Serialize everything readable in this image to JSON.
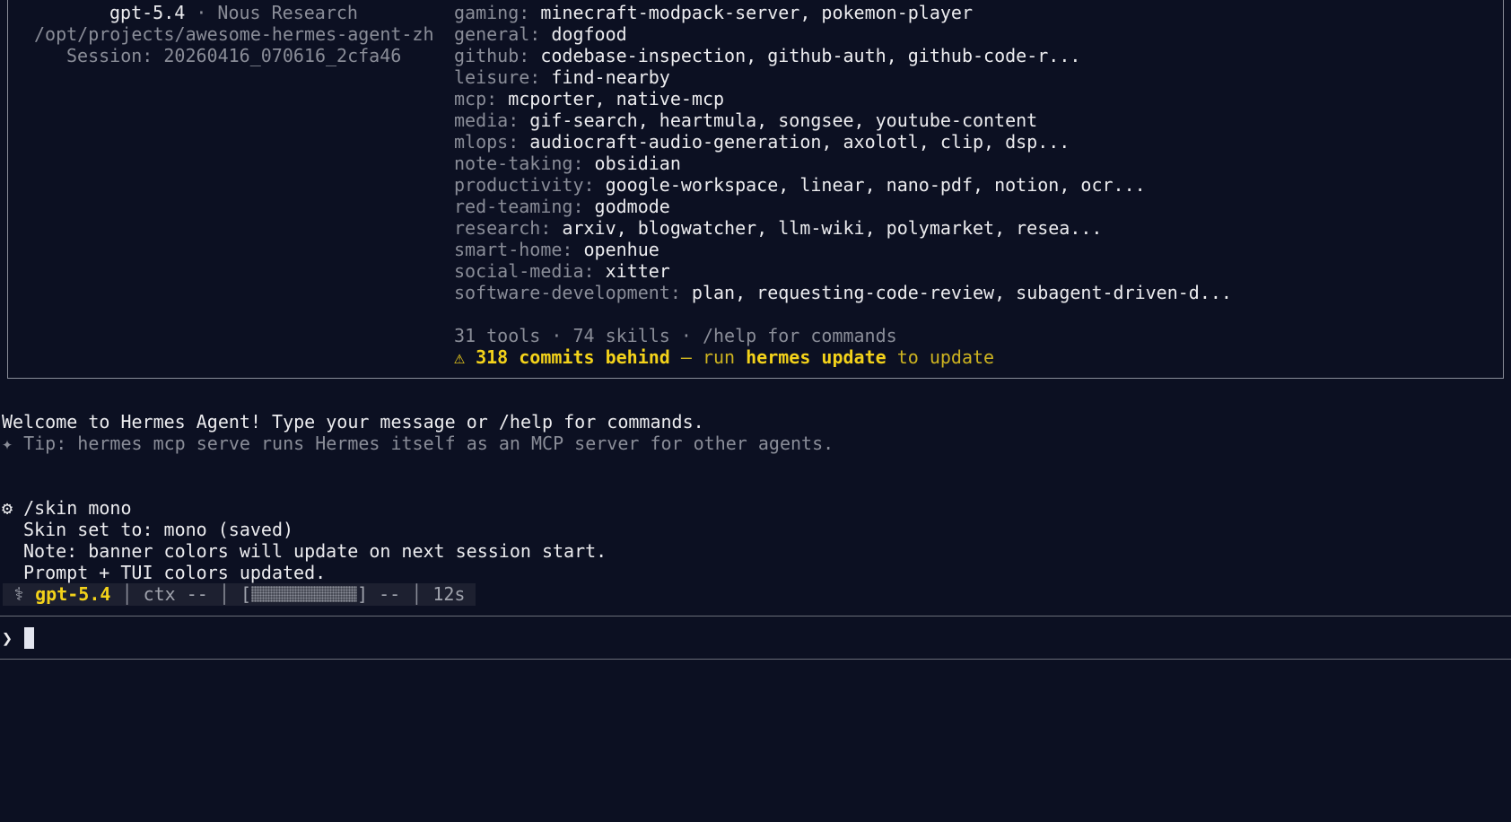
{
  "banner": {
    "model": "gpt-5.4",
    "separator": " · ",
    "provider": "Nous Research",
    "path": "/opt/projects/awesome-hermes-agent-zh",
    "session": "Session: 20260416_070616_2cfa46",
    "skills": [
      {
        "category": "gaming:",
        "items": "minecraft-modpack-server, pokemon-player"
      },
      {
        "category": "general:",
        "items": "dogfood"
      },
      {
        "category": "github:",
        "items": "codebase-inspection, github-auth, github-code-r..."
      },
      {
        "category": "leisure:",
        "items": "find-nearby"
      },
      {
        "category": "mcp:",
        "items": "mcporter, native-mcp"
      },
      {
        "category": "media:",
        "items": "gif-search, heartmula, songsee, youtube-content"
      },
      {
        "category": "mlops:",
        "items": "audiocraft-audio-generation, axolotl, clip, dsp..."
      },
      {
        "category": "note-taking:",
        "items": "obsidian"
      },
      {
        "category": "productivity:",
        "items": "google-workspace, linear, nano-pdf, notion, ocr..."
      },
      {
        "category": "red-teaming:",
        "items": "godmode"
      },
      {
        "category": "research:",
        "items": "arxiv, blogwatcher, llm-wiki, polymarket, resea..."
      },
      {
        "category": "smart-home:",
        "items": "openhue"
      },
      {
        "category": "social-media:",
        "items": "xitter"
      },
      {
        "category": "software-development:",
        "items": "plan, requesting-code-review, subagent-driven-d..."
      }
    ],
    "summary": "31 tools · 74 skills · /help for commands",
    "update_warning": {
      "icon": "⚠",
      "count": "318 commits behind",
      "mid": " — run ",
      "command": "hermes update",
      "tail": " to update"
    }
  },
  "welcome": "Welcome to Hermes Agent! Type your message or /help for commands.",
  "tip": "✦ Tip: hermes mcp serve runs Hermes itself as an MCP server for other agents.",
  "command": {
    "icon": "⚙",
    "text": " /skin mono",
    "output": [
      "Skin set to: mono (saved)",
      "Note: banner colors will update on next session start.",
      "Prompt + TUI colors updated."
    ]
  },
  "status": {
    "icon": "⚕",
    "model": "gpt-5.4",
    "ctx": "ctx --",
    "bar_open": "[",
    "bar_close": "]",
    "bar_value": "--",
    "elapsed": "12s"
  },
  "prompt": {
    "symbol": "❯"
  }
}
